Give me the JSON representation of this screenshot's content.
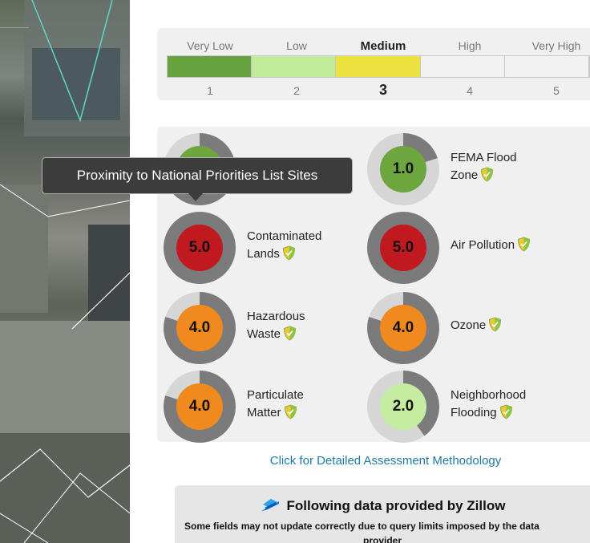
{
  "scale": {
    "levels": [
      {
        "label": "Very Low",
        "number": "1",
        "color": "#67a43f"
      },
      {
        "label": "Low",
        "number": "2",
        "color": "#bfeb9a"
      },
      {
        "label": "Medium",
        "number": "3",
        "color": "#ece23f"
      },
      {
        "label": "High",
        "number": "4",
        "color": "#f2f2f2"
      },
      {
        "label": "Very High",
        "number": "5",
        "color": "#f2f2f2"
      }
    ],
    "selected_index": 2
  },
  "tooltip": {
    "text": "Proximity to National Priorities List Sites"
  },
  "factors": [
    {
      "id": "superfund",
      "line1": "",
      "line2": "",
      "score": "",
      "fill": 0.8,
      "color": "#6da53f",
      "partial": true
    },
    {
      "id": "fema",
      "line1": "FEMA Flood",
      "line2": "Zone",
      "score": "1.0",
      "fill": 0.2,
      "color": "#6da53f"
    },
    {
      "id": "contaminated",
      "line1": "Contaminated",
      "line2": "Lands",
      "score": "5.0",
      "fill": 1.0,
      "color": "#c0191f"
    },
    {
      "id": "air",
      "line1": "Air Pollution",
      "line2": "",
      "score": "5.0",
      "fill": 1.0,
      "color": "#c0191f"
    },
    {
      "id": "hazardous",
      "line1": "Hazardous",
      "line2": "Waste",
      "score": "4.0",
      "fill": 0.8,
      "color": "#f0891e"
    },
    {
      "id": "ozone",
      "line1": "Ozone",
      "line2": "",
      "score": "4.0",
      "fill": 0.8,
      "color": "#f0891e"
    },
    {
      "id": "particulate",
      "line1": "Particulate",
      "line2": "Matter",
      "score": "4.0",
      "fill": 0.8,
      "color": "#f0891e"
    },
    {
      "id": "neighborhood",
      "line1": "Neighborhood",
      "line2": "Flooding",
      "score": "2.0",
      "fill": 0.4,
      "color": "#c4eda1"
    }
  ],
  "colors": {
    "ring_fill": "#7b7b7b",
    "ring_empty": "#d6d6d6",
    "link": "#1f7ba6"
  },
  "methodology_link": "Click for Detailed Assessment Methodology",
  "zillow": {
    "heading": "Following data provided by Zillow",
    "note": "Some fields may not update correctly due to query limits imposed by the data",
    "note2": "provider"
  },
  "icons": {
    "shield": "shield-check-icon",
    "zillow": "zillow-logo-icon"
  }
}
